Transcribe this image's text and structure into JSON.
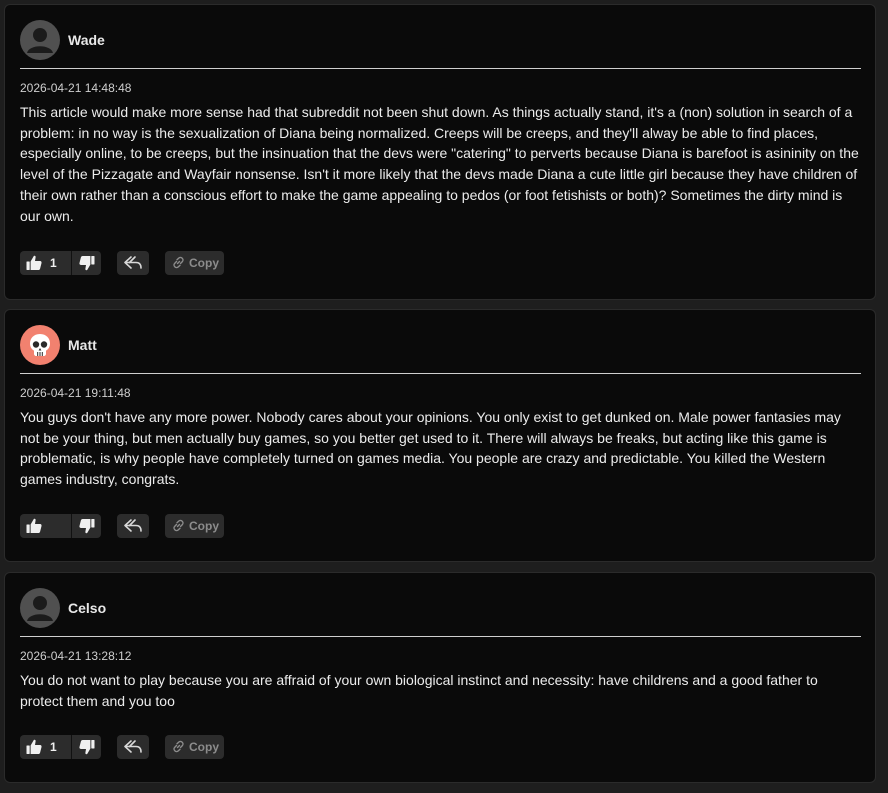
{
  "comments": [
    {
      "username": "Wade",
      "avatar": "default-user-avatar",
      "timestamp": "2026-04-21 14:48:48",
      "text": "This article would make more sense had that subreddit not been shut down. As things actually stand, it's a (non) solution in search of a problem: in no way is the sexualization of Diana being normalized. Creeps will be creeps, and they'll alway be able to find places, especially online, to be creeps, but the insinuation that the devs were \"catering\" to perverts because Diana is barefoot is asininity on the level of the Pizzagate and Wayfair nonsense. Isn't it more likely that the devs made Diana a cute little girl because they have children of their own rather than a conscious effort to make the game appealing to pedos (or foot fetishists or both)? Sometimes the dirty mind is our own.",
      "likes": "1",
      "copy_label": "Copy"
    },
    {
      "username": "Matt",
      "avatar": "skull-avatar",
      "timestamp": "2026-04-21 19:11:48",
      "text": "You guys don't have any more power. Nobody cares about your opinions. You only exist to get dunked on. Male power fantasies may not be your thing, but men actually buy games, so you better get used to it. There will always be freaks, but acting like this game is problematic, is why people have completely turned on games media. You people are crazy and predictable. You killed the Western games industry, congrats.",
      "likes": "",
      "copy_label": "Copy"
    },
    {
      "username": "Celso",
      "avatar": "default-user-avatar",
      "timestamp": "2026-04-21 13:28:12",
      "text": "You do not want to play because you are affraid of your own biological instinct and necessity: have childrens and a good father to protect them and you too",
      "likes": "1",
      "copy_label": "Copy"
    }
  ],
  "colors": {
    "background": "#1e1e1e",
    "card": "#0a0a0a",
    "button": "#2c2c2c",
    "skull_avatar": "#f2816f"
  }
}
